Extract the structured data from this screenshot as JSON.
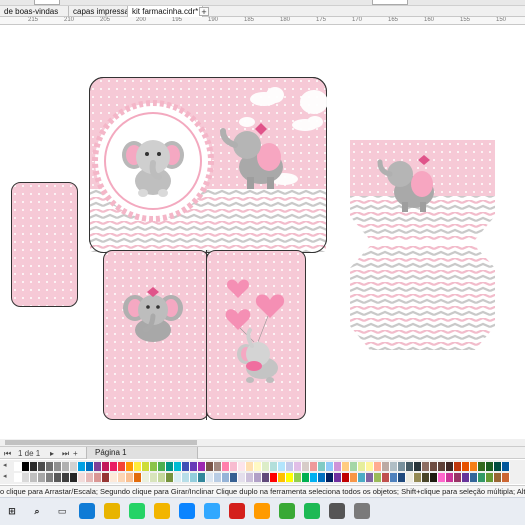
{
  "window": {
    "tabs": [
      {
        "label": "de boas-vindas"
      },
      {
        "label": "capas impressao.cdr"
      },
      {
        "label": "kit farmacinha.cdr*"
      }
    ],
    "add_tab": "+"
  },
  "ruler": {
    "labels": [
      "215",
      "210",
      "205",
      "200",
      "195",
      "190",
      "185",
      "180",
      "175",
      "170",
      "165",
      "160",
      "155",
      "150"
    ]
  },
  "pagebar": {
    "page_counter": "1 de 1",
    "page_tab": "Página 1"
  },
  "status": {
    "hint": "o clique para Arrastar/Escala; Segundo clique para Girar/Inclinar Clique duplo na ferramenta seleciona todos os objetos; Shift+clique para seleção múltipla; Alt+clique aprofunda"
  },
  "palette": {
    "row1": [
      "#ffffff",
      "#000000",
      "#2b2b2b",
      "#4d4d4d",
      "#6e6e6e",
      "#8f8f8f",
      "#b0b0b0",
      "#d1d1d1",
      "#00a0e3",
      "#0070c0",
      "#7f3f98",
      "#c2185b",
      "#e91e63",
      "#f44336",
      "#ff9800",
      "#ffeb3b",
      "#cddc39",
      "#8bc34a",
      "#4caf50",
      "#009688",
      "#00bcd4",
      "#3f51b5",
      "#673ab7",
      "#9c27b0",
      "#795548",
      "#a1887f",
      "#ff80ab",
      "#f8bbd0",
      "#fce4ec",
      "#ffe0b2",
      "#fff9c4",
      "#dcedc8",
      "#b2dfdb",
      "#b3e5fc",
      "#c5cae9",
      "#e1bee7",
      "#d7ccc8",
      "#ef9a9a",
      "#80cbc4",
      "#90caf9",
      "#ce93d8",
      "#ffcc80",
      "#a5d6a7",
      "#e6ee9c",
      "#fff59d",
      "#ffab91",
      "#bcaaa4",
      "#b0bec5",
      "#78909c",
      "#455a64",
      "#263238",
      "#8d6e63",
      "#6d4c41",
      "#5d4037",
      "#3e2723",
      "#bf360c",
      "#e65100",
      "#f57f17",
      "#33691e",
      "#1b5e20",
      "#004d40",
      "#01579b"
    ],
    "row2": [
      "#ffffff",
      "#d9d9d9",
      "#bfbfbf",
      "#a6a6a6",
      "#808080",
      "#595959",
      "#404040",
      "#262626",
      "#f2dcdb",
      "#e6b9b8",
      "#da9694",
      "#963634",
      "#fde9d9",
      "#fcd5b4",
      "#fabf8f",
      "#e26b0a",
      "#ebf1de",
      "#d8e4bc",
      "#c4d79b",
      "#76933c",
      "#daeef3",
      "#b7dee8",
      "#92cddc",
      "#31869b",
      "#dce6f1",
      "#b8cce4",
      "#95b3d7",
      "#366092",
      "#e4dfec",
      "#ccc0da",
      "#b1a0c7",
      "#60497a",
      "#ff0000",
      "#ffc000",
      "#ffff00",
      "#92d050",
      "#00b050",
      "#00b0f0",
      "#0070c0",
      "#002060",
      "#7030a0",
      "#c00000",
      "#f79646",
      "#4bacc6",
      "#8064a2",
      "#9bbb59",
      "#c0504d",
      "#4f81bd",
      "#1f497d",
      "#eeece1",
      "#948a54",
      "#494529",
      "#1d1b10",
      "#ff66cc",
      "#cc3399",
      "#993366",
      "#663399",
      "#336699",
      "#339966",
      "#669933",
      "#996633",
      "#cc6633"
    ]
  },
  "taskbar": {
    "icons": [
      "start-icon",
      "search-icon",
      "taskview-icon",
      "edge-icon",
      "chrome-icon",
      "whatsapp-icon",
      "folder-icon",
      "store-icon",
      "photoshop-icon",
      "acrobat-icon",
      "illustrator-icon",
      "coreldraw-icon",
      "spotify-icon",
      "media-icon",
      "misc-icon"
    ]
  }
}
